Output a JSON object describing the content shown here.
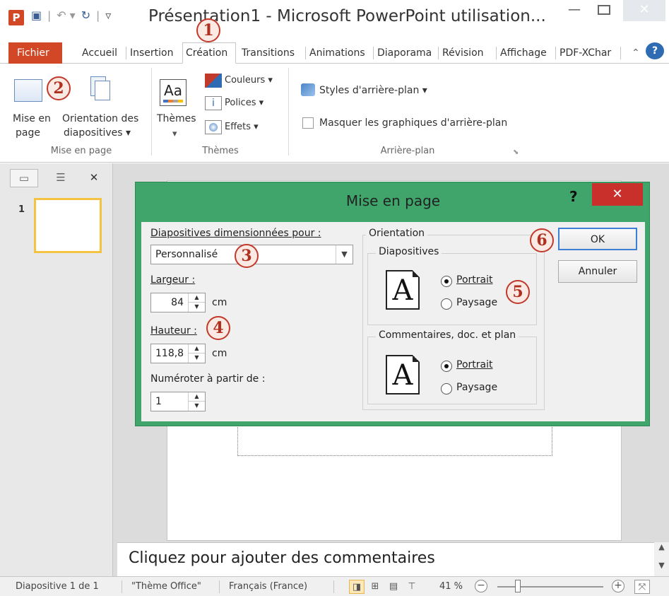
{
  "window": {
    "app_icon": "P",
    "title": "Présentation1 - Microsoft PowerPoint utilisation...",
    "qat_icons": [
      "save-icon",
      "undo-icon",
      "redo-icon",
      "customize-icon"
    ]
  },
  "tabs": [
    "Fichier",
    "Accueil",
    "Insertion",
    "Création",
    "Transitions",
    "Animations",
    "Diaporama",
    "Révision",
    "Affichage",
    "PDF-XChar"
  ],
  "ribbon": {
    "mise_en_page": {
      "btn_page_line1": "Mise en",
      "btn_page_line2": "page",
      "btn_orient_line1": "Orientation des",
      "btn_orient_line2": "diapositives ▾",
      "label": "Mise en page"
    },
    "themes": {
      "themes_btn": "Thèmes",
      "couleurs": "Couleurs ▾",
      "polices": "Polices ▾",
      "effets": "Effets ▾",
      "label": "Thèmes"
    },
    "arriere_plan": {
      "styles": "Styles d'arrière-plan ▾",
      "masquer": "Masquer les graphiques d'arrière-plan",
      "label": "Arrière-plan"
    }
  },
  "slides_pane": {
    "thumb_number": "1"
  },
  "notes": {
    "placeholder": "Cliquez pour ajouter des commentaires"
  },
  "status_bar": {
    "slide": "Diapositive 1 de 1",
    "theme": "\"Thème Office\"",
    "language": "Français (France)",
    "zoom": "41 %"
  },
  "dialog": {
    "title": "Mise en page",
    "help": "?",
    "close": "✕",
    "size_label": "Diapositives dimensionnées pour :",
    "size_value": "Personnalisé",
    "width_label": "Largeur :",
    "width_value": "84",
    "height_label": "Hauteur :",
    "height_value": "118,8",
    "unit": "cm",
    "number_label": "Numéroter à partir de :",
    "number_value": "1",
    "orientation_label": "Orientation",
    "slides_label": "Diapositives",
    "notes_label": "Commentaires, doc. et plan",
    "portrait": "Portrait",
    "paysage": "Paysage",
    "ok": "OK",
    "cancel": "Annuler"
  },
  "annotations": [
    "1",
    "2",
    "3",
    "4",
    "5",
    "6"
  ],
  "colors": {
    "accent_file": "#d24726",
    "dialog_frame": "#3fa56b",
    "close_red": "#c9302c",
    "marker_red": "#c0392b"
  }
}
